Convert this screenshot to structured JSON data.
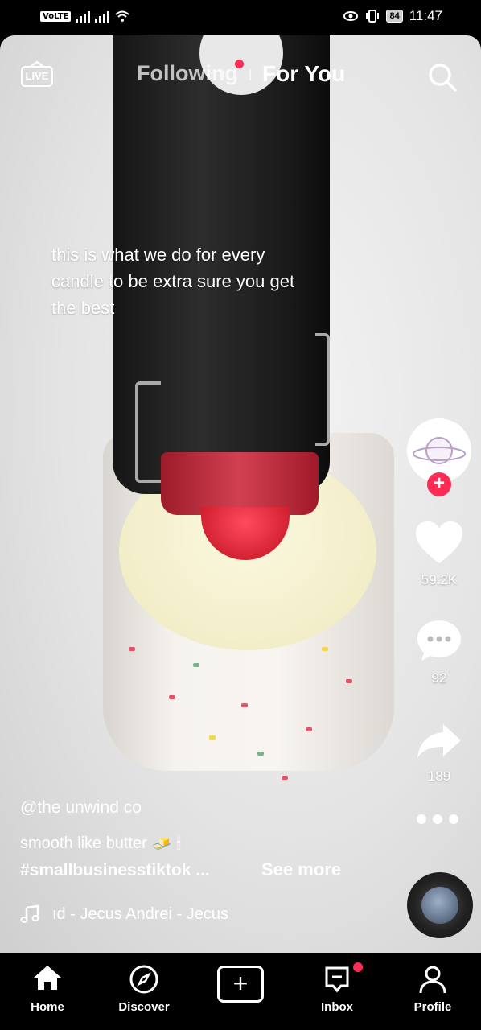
{
  "status_bar": {
    "volte": "VoLTE",
    "battery": "84",
    "time": "11:47"
  },
  "top_nav": {
    "live_label": "LIVE",
    "following_label": "Following",
    "for_you_label": "For You"
  },
  "video": {
    "overlay_caption": "this is what we do for every candle to be extra sure you get the best",
    "likes": "59.2K",
    "comments": "92",
    "shares": "189",
    "username": "@the unwind co",
    "description": "smooth like butter",
    "description_emoji": "🧈 🕯",
    "hashtags": "#smallbusinesstiktok  ...",
    "see_more": "See more",
    "music": "ıd - Jecus Andrei - Jecus"
  },
  "bottom_nav": {
    "items": [
      {
        "label": "Home",
        "icon": "home-icon"
      },
      {
        "label": "Discover",
        "icon": "compass-icon"
      },
      {
        "label": "",
        "icon": "plus-icon"
      },
      {
        "label": "Inbox",
        "icon": "inbox-icon"
      },
      {
        "label": "Profile",
        "icon": "person-icon"
      }
    ]
  },
  "colors": {
    "accent": "#fe2c55",
    "background": "#000000"
  }
}
